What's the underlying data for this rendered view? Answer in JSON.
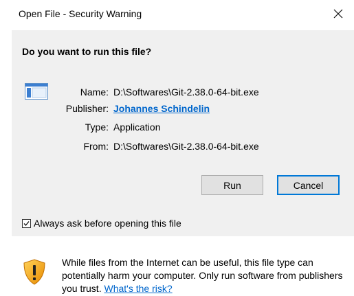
{
  "window": {
    "title": "Open File - Security Warning",
    "close_icon": "close-icon"
  },
  "main": {
    "question": "Do you want to run this file?",
    "file_icon": "application-icon",
    "fields": {
      "name_label": "Name:",
      "name_value": "D:\\Softwares\\Git-2.38.0-64-bit.exe",
      "publisher_label": "Publisher:",
      "publisher_value": "Johannes Schindelin",
      "type_label": "Type:",
      "type_value": "Application",
      "from_label": "From:",
      "from_value": "D:\\Softwares\\Git-2.38.0-64-bit.exe"
    },
    "buttons": {
      "run_label": "Run",
      "cancel_label": "Cancel"
    },
    "checkbox": {
      "label": "Always ask before opening this file",
      "checked": true
    }
  },
  "footer": {
    "shield_icon": "warning-shield-icon",
    "message": "While files from the Internet can be useful, this file type can potentially harm your computer. Only run software from publishers you trust.",
    "risk_link": "What's the risk?"
  },
  "colors": {
    "link": "#0066cc",
    "panel": "#f0f0f0",
    "default_button_border": "#0078d7",
    "shield_orange": "#f5a623"
  }
}
